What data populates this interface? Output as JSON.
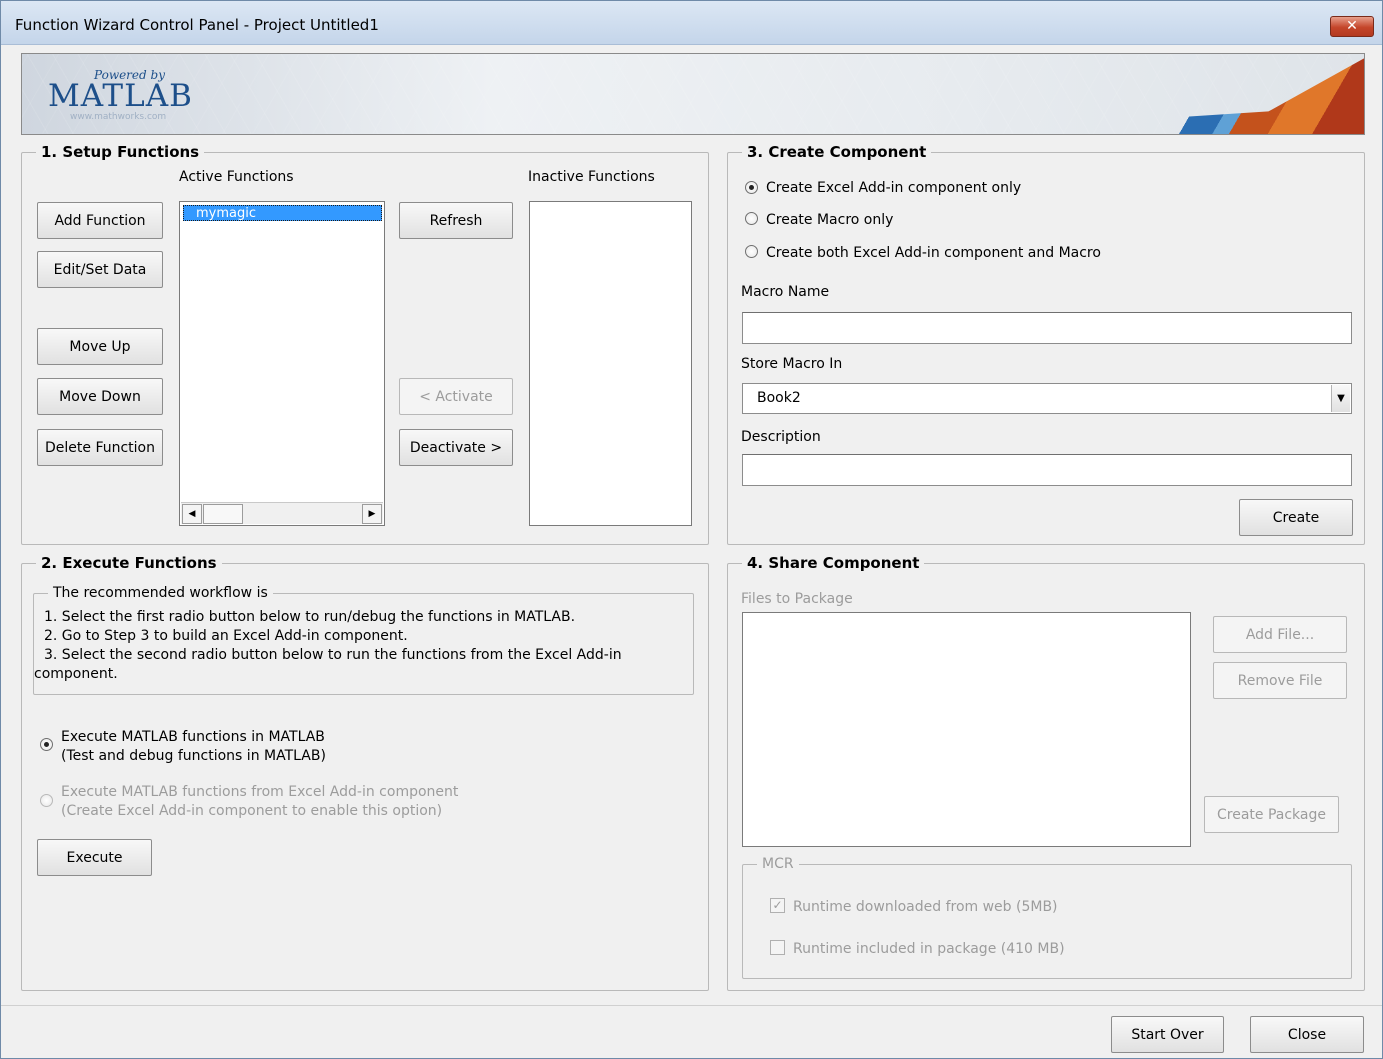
{
  "window": {
    "title": "Function Wizard Control Panel - Project Untitled1",
    "close_glyph": "✕"
  },
  "banner": {
    "powered_by": "Powered by",
    "logo": "MATLAB",
    "url": "www.mathworks.com"
  },
  "setup": {
    "title": "1. Setup Functions",
    "active_label": "Active Functions",
    "inactive_label": "Inactive Functions",
    "active_items": [
      "mymagic"
    ],
    "buttons": {
      "add_function": "Add Function",
      "edit_set_data": "Edit/Set Data",
      "move_up": "Move Up",
      "move_down": "Move Down",
      "delete_function": "Delete Function",
      "refresh": "Refresh",
      "activate": "< Activate",
      "deactivate": "Deactivate >"
    }
  },
  "execute": {
    "title": "2. Execute Functions",
    "workflow_title": "The recommended workflow is",
    "workflow_lines": [
      "1. Select the first radio button below to run/debug the functions in MATLAB.",
      "2. Go to Step 3 to build an Excel Add-in component.",
      "3. Select the second radio button below to run the functions from the Excel Add-in",
      "component."
    ],
    "option1_line1": "Execute MATLAB functions in MATLAB",
    "option1_line2": "(Test and debug functions in MATLAB)",
    "option2_line1": "Execute MATLAB functions from Excel Add-in component",
    "option2_line2": "(Create Excel Add-in component to enable this option)",
    "execute_button": "Execute"
  },
  "create": {
    "title": "3. Create Component",
    "radio1": "Create Excel Add-in component only",
    "radio2": "Create Macro only",
    "radio3": "Create both Excel Add-in component and Macro",
    "macro_name_label": "Macro Name",
    "macro_name_value": "",
    "store_label": "Store Macro In",
    "store_value": "Book2",
    "description_label": "Description",
    "description_value": "",
    "create_button": "Create"
  },
  "share": {
    "title": "4. Share Component",
    "files_label": "Files to Package",
    "add_file": "Add File...",
    "remove_file": "Remove File",
    "create_package": "Create Package",
    "mcr_title": "MCR",
    "mcr_option1": "Runtime downloaded from web (5MB)",
    "mcr_option2": "Runtime included in package (410 MB)"
  },
  "footer": {
    "start_over": "Start Over",
    "close": "Close"
  }
}
